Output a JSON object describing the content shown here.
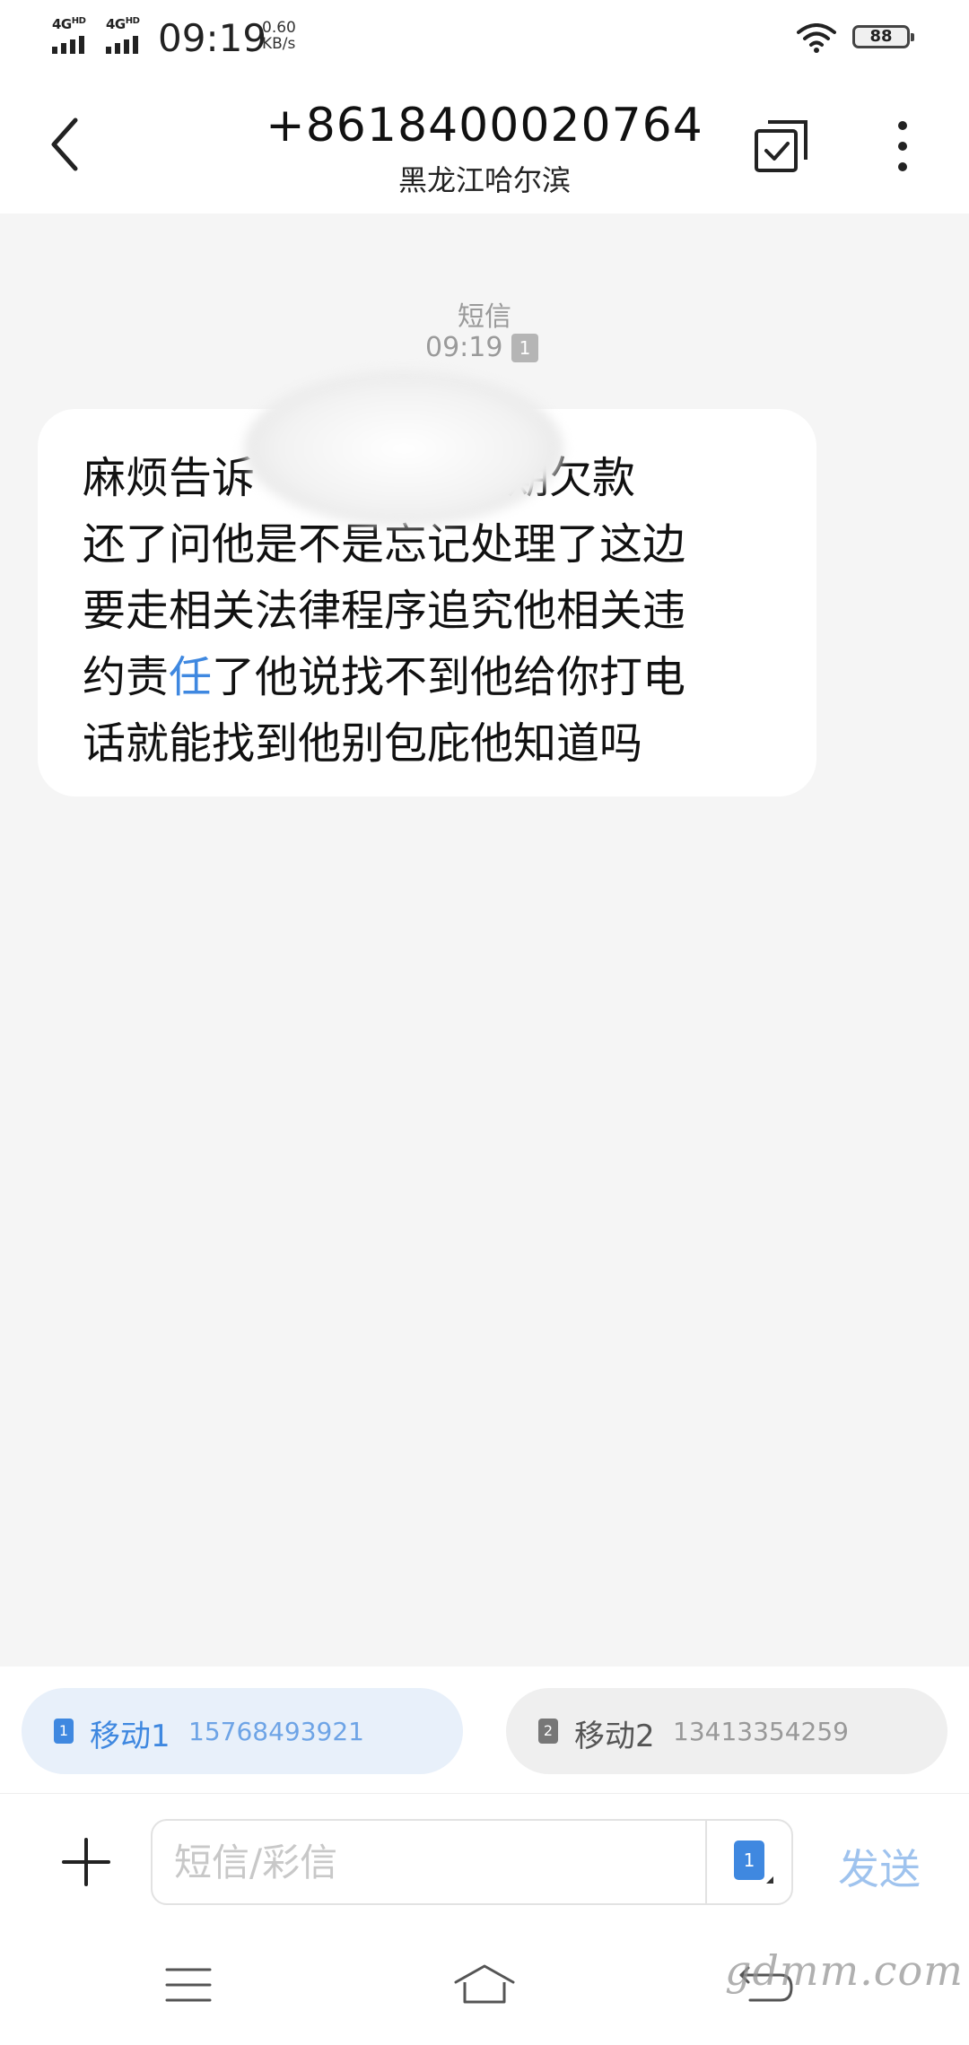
{
  "status_bar": {
    "sim1_network": "4G",
    "sim1_network_suffix": "HD",
    "sim2_network": "4G",
    "sim2_network_suffix": "HD",
    "time": "09:19",
    "speed_value": "0.60",
    "speed_unit": "KB/s",
    "battery": "88",
    "wifi_icon": "wifi-icon"
  },
  "header": {
    "phone_number": "+8618400020764",
    "location": "黑龙江哈尔滨",
    "back_icon": "chevron-left-icon",
    "select_icon": "checkbox-icon",
    "more_icon": "more-vertical-icon"
  },
  "conversation": {
    "message_type": "短信",
    "time": "09:19",
    "sim_slot": "1",
    "message_lines": [
      "麻烦告诉",
      "还了问他是不是忘记处理了这边",
      "要走相关法律程序追究他相关违",
      "约责",
      "话就能找到他别包庇他知道吗"
    ],
    "line1_end": "逾期欠款",
    "line4_highlight": "任",
    "line4_rest": "了他说找不到他给你打电"
  },
  "sim_selector": {
    "sim1": {
      "index": "1",
      "name": "移动1",
      "number": "15768493921"
    },
    "sim2": {
      "index": "2",
      "name": "移动2",
      "number": "13413354259"
    }
  },
  "composer": {
    "placeholder": "短信/彩信",
    "sim_slot": "1",
    "send_label": "发送",
    "plus_icon": "plus-icon"
  },
  "nav_bar": {
    "menu_icon": "menu-icon",
    "home_icon": "home-icon",
    "back_icon": "back-icon",
    "watermark": "gdmm.com"
  },
  "colors": {
    "accent": "#3f88e0",
    "background": "#f5f5f5",
    "bubble": "#ffffff",
    "send_disabled": "#9fc3ee"
  }
}
